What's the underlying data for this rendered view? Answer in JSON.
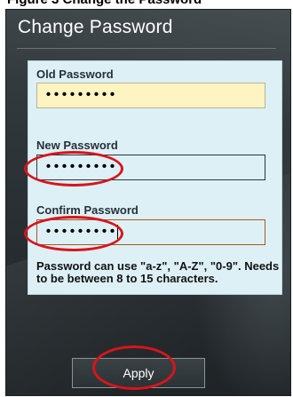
{
  "caption": "Figure 3 Change the Password",
  "dialog": {
    "title": "Change Password",
    "old_password": {
      "label": "Old Password",
      "value": "•••••••••"
    },
    "new_password": {
      "label": "New Password",
      "value": "•••••••••"
    },
    "confirm_password": {
      "label": "Confirm Password",
      "value": "•••••••••"
    },
    "hint": "Password can use \"a-z\", \"A-Z\", \"0-9\". Needs to be between 8 to 15 characters.",
    "apply_label": "Apply"
  },
  "annotations": {
    "color": "#d8141c",
    "targets": [
      "new-password-field",
      "confirm-password-field",
      "apply-button"
    ]
  },
  "colors": {
    "panel_background": "#2f363a",
    "form_background": "#ddf0f6",
    "old_field_background": "#fdf4c1",
    "confirm_field_border": "#a35a25"
  }
}
